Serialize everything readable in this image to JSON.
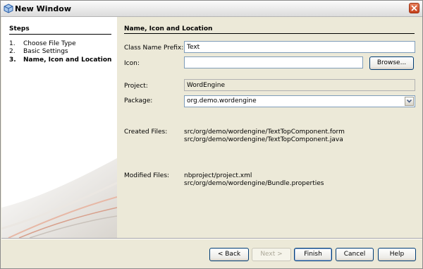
{
  "window": {
    "title": "New Window",
    "icon": "netbeans-cube-icon",
    "close_icon": "close-icon"
  },
  "steps": {
    "title": "Steps",
    "items": [
      {
        "num": "1.",
        "label": "Choose File Type",
        "active": false
      },
      {
        "num": "2.",
        "label": "Basic Settings",
        "active": false
      },
      {
        "num": "3.",
        "label": "Name, Icon and Location",
        "active": true
      }
    ]
  },
  "main": {
    "section_title": "Name, Icon and Location",
    "class_name_prefix": {
      "label": "Class Name Prefix:",
      "value": "Text"
    },
    "icon": {
      "label": "Icon:",
      "value": "",
      "browse_label": "Browse..."
    },
    "project": {
      "label": "Project:",
      "value": "WordEngine"
    },
    "package": {
      "label": "Package:",
      "value": "org.demo.wordengine"
    },
    "created_files": {
      "label": "Created Files:",
      "files": [
        "src/org/demo/wordengine/TextTopComponent.form",
        "src/org/demo/wordengine/TextTopComponent.java"
      ]
    },
    "modified_files": {
      "label": "Modified Files:",
      "files": [
        "nbproject/project.xml",
        "src/org/demo/wordengine/Bundle.properties"
      ]
    }
  },
  "buttons": {
    "back": "< Back",
    "next": "Next >",
    "finish": "Finish",
    "cancel": "Cancel",
    "help": "Help"
  },
  "colors": {
    "dialog_bg": "#ece9d8",
    "field_border": "#7f9db9",
    "button_border": "#003c74",
    "close_button": "#c6401b"
  }
}
